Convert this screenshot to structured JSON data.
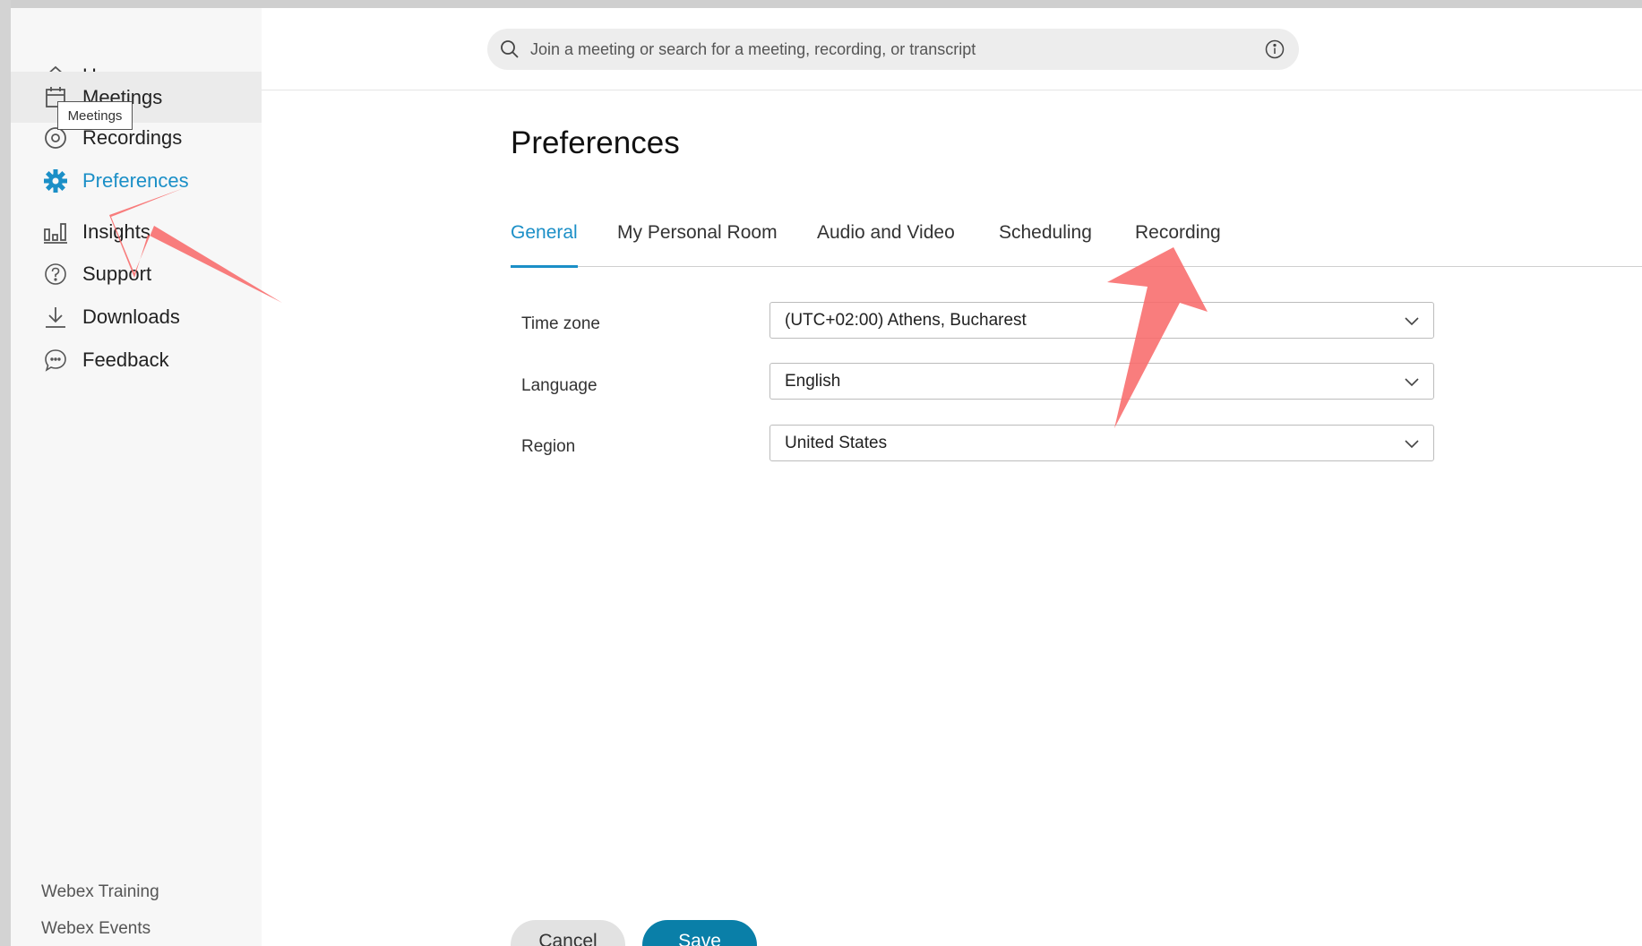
{
  "sidebar": {
    "items": [
      {
        "label": "Home",
        "icon": "home-icon"
      },
      {
        "label": "Meetings",
        "icon": "calendar-icon"
      },
      {
        "label": "Recordings",
        "icon": "recording-icon"
      },
      {
        "label": "Preferences",
        "icon": "gear-icon"
      },
      {
        "label": "Insights",
        "icon": "bar-chart-icon"
      },
      {
        "label": "Support",
        "icon": "help-icon"
      },
      {
        "label": "Downloads",
        "icon": "download-icon"
      },
      {
        "label": "Feedback",
        "icon": "chat-icon"
      }
    ],
    "tooltip": "Meetings",
    "footer": [
      "Webex Training",
      "Webex Events"
    ]
  },
  "search": {
    "placeholder": "Join a meeting or search for a meeting, recording, or transcript"
  },
  "main": {
    "title": "Preferences",
    "tabs": [
      {
        "label": "General",
        "active": true
      },
      {
        "label": "My Personal Room"
      },
      {
        "label": "Audio and Video"
      },
      {
        "label": "Scheduling"
      },
      {
        "label": "Recording"
      }
    ],
    "fields": [
      {
        "label": "Time zone",
        "value": "(UTC+02:00) Athens, Bucharest"
      },
      {
        "label": "Language",
        "value": "English"
      },
      {
        "label": "Region",
        "value": "United States"
      }
    ],
    "buttons": {
      "cancel": "Cancel",
      "save": "Save"
    }
  },
  "colors": {
    "accent": "#1b8fc7",
    "save_button": "#0a7fa8",
    "annotation_arrow": "#f86b6b"
  }
}
